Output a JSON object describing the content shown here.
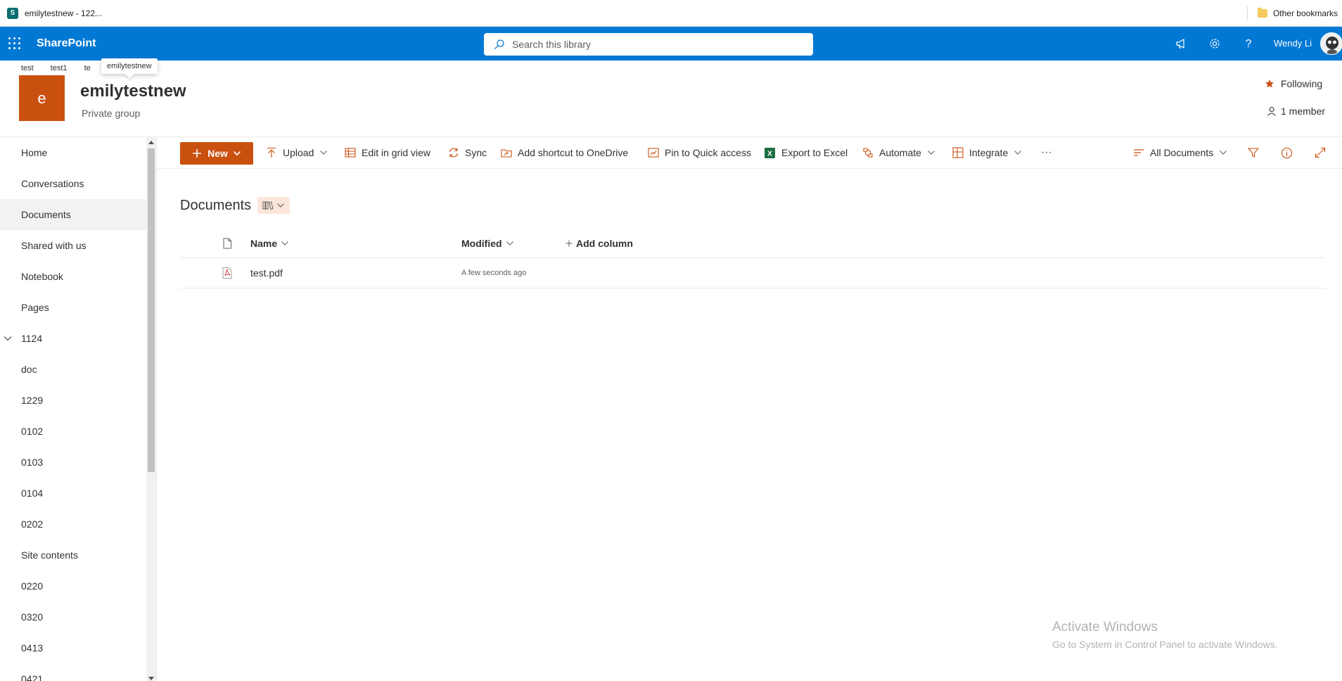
{
  "browser": {
    "tab_title": "emilytestnew - 122...",
    "other_bookmarks": "Other bookmarks"
  },
  "suitebar": {
    "brand": "SharePoint",
    "search_placeholder": "Search this library",
    "user_name": "Wendy Li"
  },
  "site": {
    "hub_nav": [
      "test",
      "test1",
      "te"
    ],
    "tooltip": "emilytestnew",
    "logo_letter": "e",
    "title": "emilytestnew",
    "subtitle": "Private group",
    "following": "Following",
    "members": "1 member",
    "accent_color": "#ca5010"
  },
  "leftnav": {
    "items": [
      "Home",
      "Conversations",
      "Documents",
      "Shared with us",
      "Notebook",
      "Pages",
      "1124",
      "doc",
      "1229",
      "0102",
      "0103",
      "0104",
      "0202",
      "Site contents",
      "0220",
      "0320",
      "0413",
      "0421"
    ],
    "selected": "Documents"
  },
  "commandbar": {
    "new": "New",
    "upload": "Upload",
    "grid_view": "Edit in grid view",
    "sync": "Sync",
    "shortcut": "Add shortcut to OneDrive",
    "pin": "Pin to Quick access",
    "export": "Export to Excel",
    "automate": "Automate",
    "integrate": "Integrate",
    "more": "···",
    "view": "All Documents"
  },
  "library": {
    "title": "Documents",
    "columns": {
      "name": "Name",
      "modified": "Modified",
      "add": "Add column"
    },
    "rows": [
      {
        "name": "test.pdf",
        "modified": "A few seconds ago"
      }
    ]
  },
  "watermark": {
    "line1": "Activate Windows",
    "line2": "Go to System in Control Panel to activate Windows."
  }
}
